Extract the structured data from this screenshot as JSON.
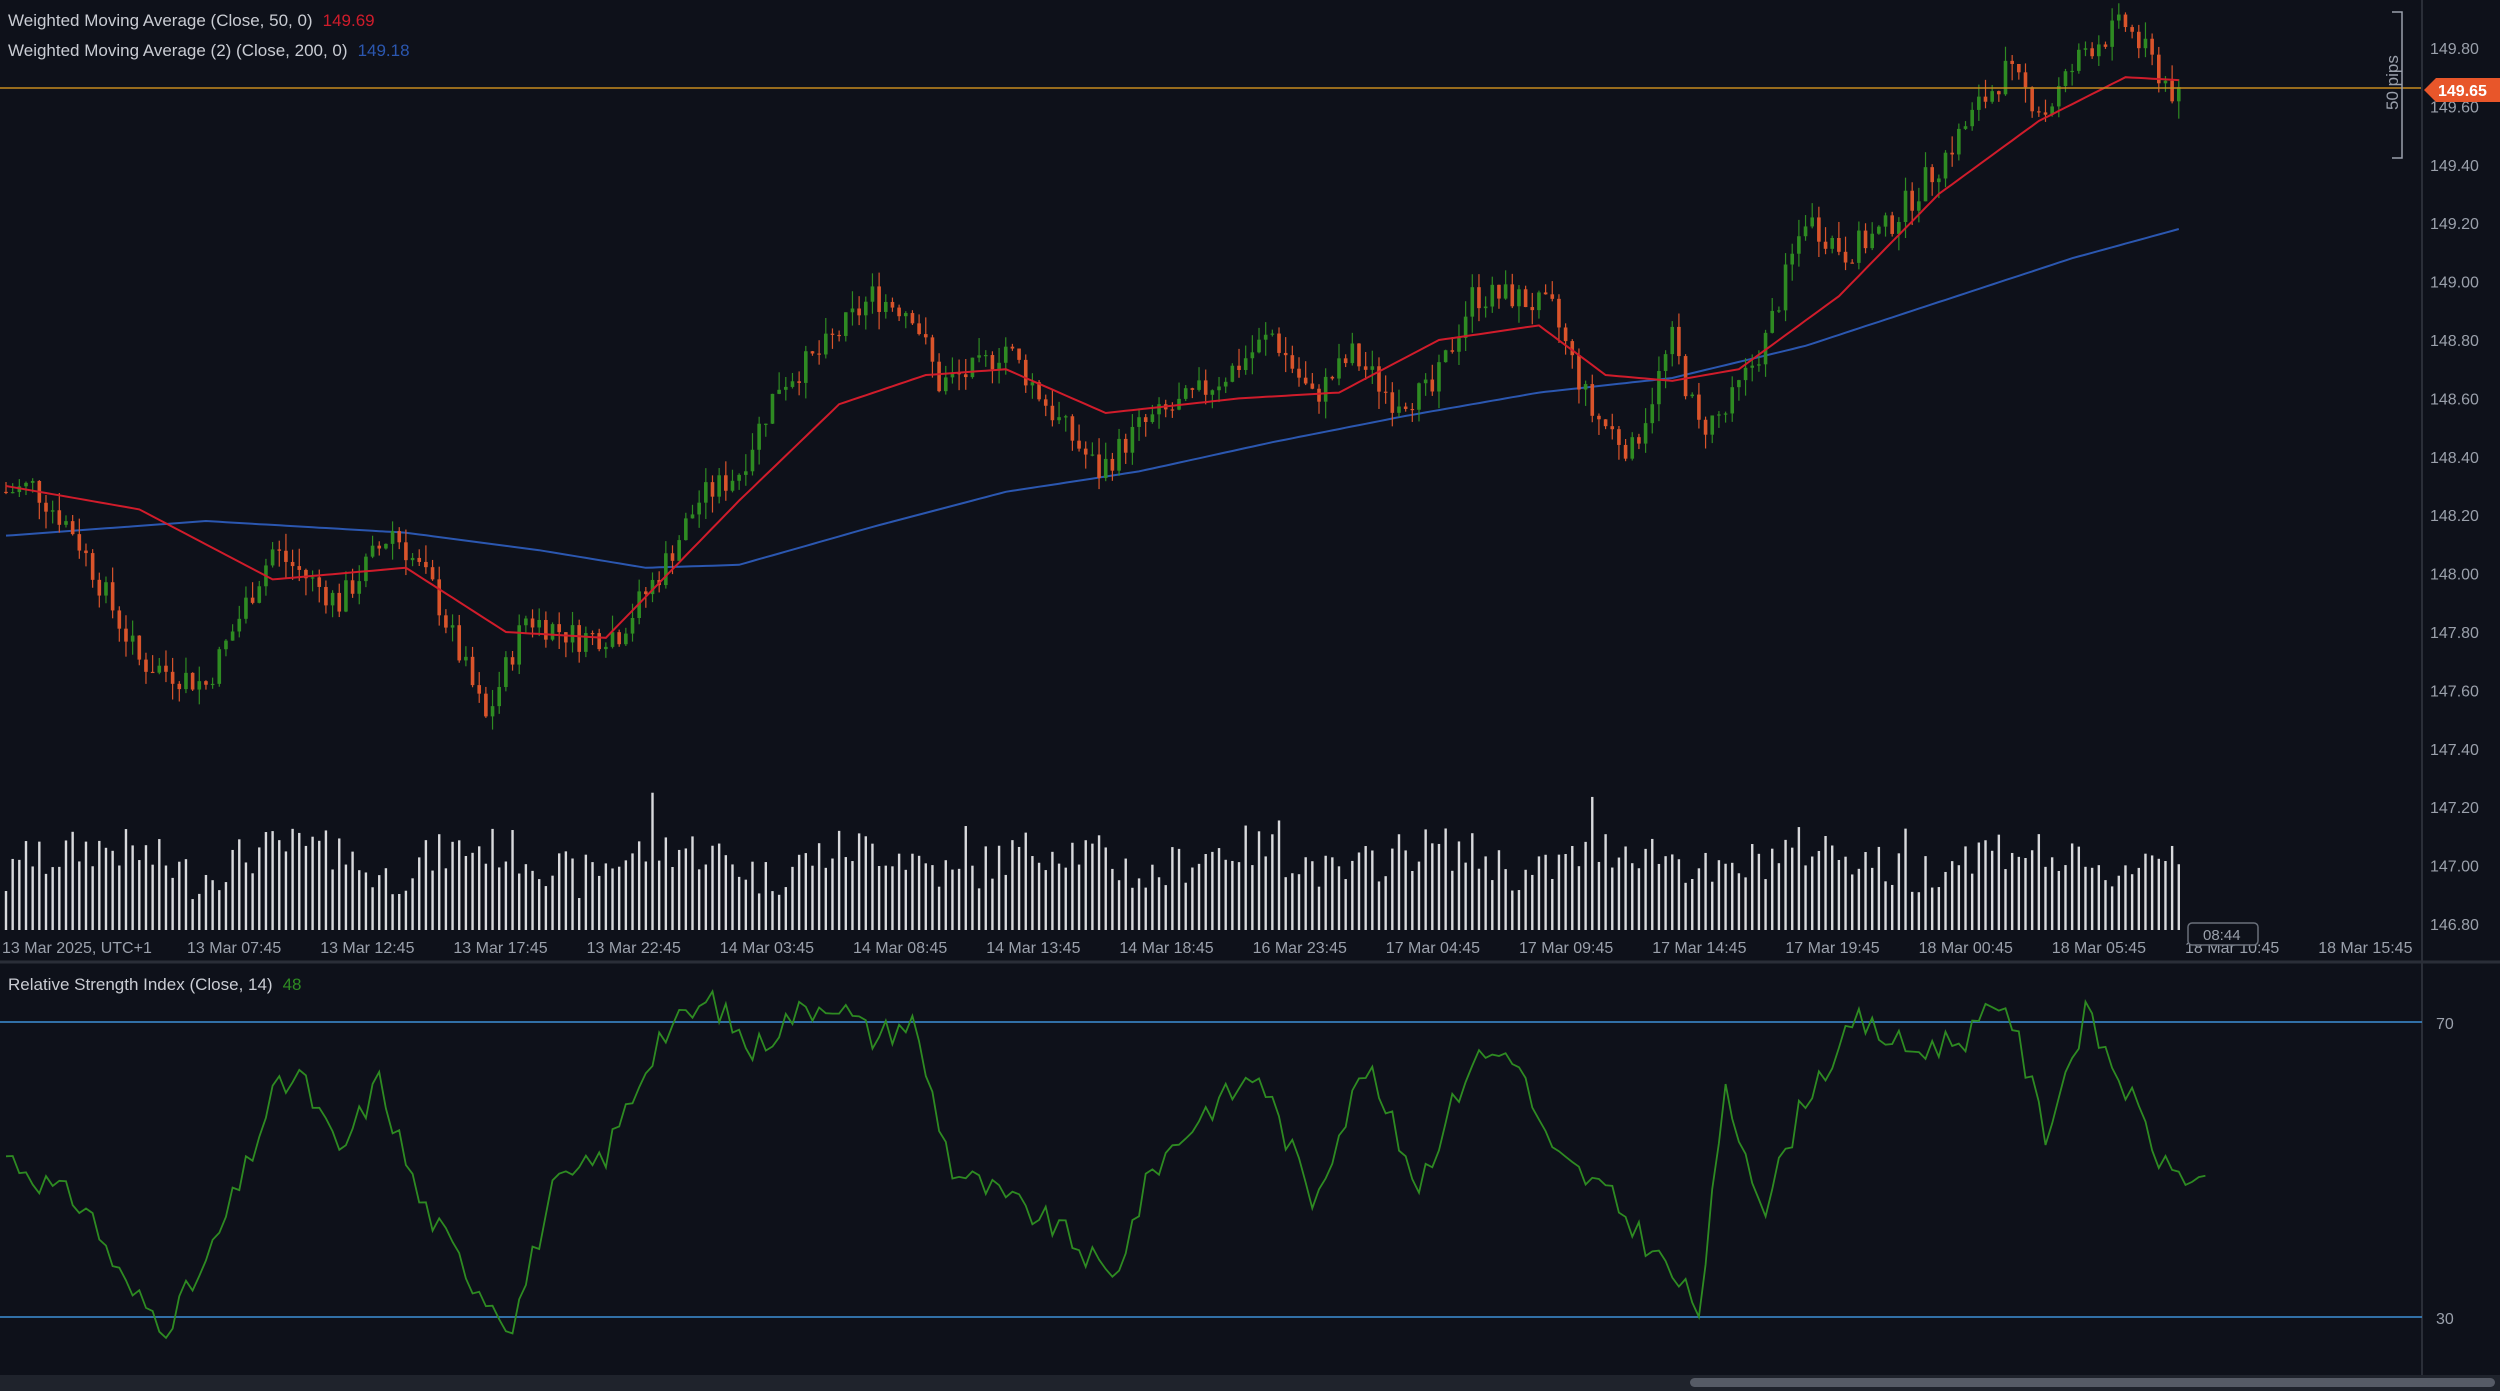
{
  "legends": {
    "wma50": {
      "label": "Weighted Moving Average (Close, 50, 0)",
      "value": "149.69",
      "color": "#d01c2b"
    },
    "wma200": {
      "label": "Weighted Moving Average (2) (Close, 200, 0)",
      "value": "149.18",
      "color": "#2b57b0"
    },
    "rsi": {
      "label": "Relative Strength Index (Close, 14)",
      "value": "48",
      "color": "#2e8b22"
    }
  },
  "price_axis": {
    "ticks": [
      "149.80",
      "149.60",
      "149.40",
      "149.20",
      "149.00",
      "148.80",
      "148.60",
      "148.40",
      "148.20",
      "148.00",
      "147.80",
      "147.60",
      "147.40",
      "147.20",
      "147.00",
      "146.80"
    ],
    "current_price": "149.65",
    "measure_label": "50 pips"
  },
  "time_axis": {
    "ticks": [
      "13 Mar 2025, UTC+1",
      "13 Mar 07:45",
      "13 Mar 12:45",
      "13 Mar 17:45",
      "13 Mar 22:45",
      "14 Mar 03:45",
      "14 Mar 08:45",
      "14 Mar 13:45",
      "14 Mar 18:45",
      "16 Mar 23:45",
      "17 Mar 04:45",
      "17 Mar 09:45",
      "17 Mar 14:45",
      "17 Mar 19:45",
      "18 Mar 00:45",
      "18 Mar 05:45",
      "18 Mar 10:45",
      "18 Mar 15:45"
    ],
    "countdown": "08:44"
  },
  "rsi_axis": {
    "upper": "70",
    "lower": "30"
  },
  "chart_data": [
    {
      "type": "candlestick",
      "name": "price",
      "ylim": [
        146.75,
        149.9
      ],
      "current_price": 149.65,
      "anchors": [
        [
          0,
          148.28
        ],
        [
          4,
          148.3
        ],
        [
          10,
          148.15
        ],
        [
          20,
          147.7
        ],
        [
          30,
          147.62
        ],
        [
          40,
          148.08
        ],
        [
          50,
          147.9
        ],
        [
          58,
          148.15
        ],
        [
          64,
          147.95
        ],
        [
          72,
          147.5
        ],
        [
          78,
          147.85
        ],
        [
          86,
          147.78
        ],
        [
          92,
          147.8
        ],
        [
          98,
          148.0
        ],
        [
          104,
          148.25
        ],
        [
          110,
          148.35
        ],
        [
          116,
          148.65
        ],
        [
          122,
          148.75
        ],
        [
          130,
          148.95
        ],
        [
          136,
          148.9
        ],
        [
          140,
          148.65
        ],
        [
          146,
          148.7
        ],
        [
          150,
          148.78
        ],
        [
          154,
          148.65
        ],
        [
          158,
          148.52
        ],
        [
          164,
          148.35
        ],
        [
          170,
          148.5
        ],
        [
          178,
          148.6
        ],
        [
          184,
          148.7
        ],
        [
          190,
          148.82
        ],
        [
          196,
          148.6
        ],
        [
          202,
          148.75
        ],
        [
          208,
          148.6
        ],
        [
          214,
          148.62
        ],
        [
          220,
          148.95
        ],
        [
          226,
          148.95
        ],
        [
          232,
          148.9
        ],
        [
          238,
          148.55
        ],
        [
          244,
          148.42
        ],
        [
          250,
          148.8
        ],
        [
          254,
          148.5
        ],
        [
          258,
          148.55
        ],
        [
          264,
          148.8
        ],
        [
          270,
          149.22
        ],
        [
          276,
          149.1
        ],
        [
          282,
          149.18
        ],
        [
          290,
          149.4
        ],
        [
          296,
          149.6
        ],
        [
          300,
          149.72
        ],
        [
          306,
          149.58
        ],
        [
          312,
          149.8
        ],
        [
          318,
          149.88
        ],
        [
          322,
          149.75
        ],
        [
          326,
          149.62
        ]
      ],
      "volume": {
        "max_height": 1
      }
    },
    {
      "type": "line",
      "name": "WMA 50",
      "values_at": [
        [
          0,
          148.3
        ],
        [
          20,
          148.22
        ],
        [
          40,
          147.98
        ],
        [
          60,
          148.02
        ],
        [
          75,
          147.8
        ],
        [
          90,
          147.78
        ],
        [
          110,
          148.25
        ],
        [
          125,
          148.58
        ],
        [
          138,
          148.68
        ],
        [
          150,
          148.7
        ],
        [
          165,
          148.55
        ],
        [
          185,
          148.6
        ],
        [
          200,
          148.62
        ],
        [
          215,
          148.8
        ],
        [
          230,
          148.85
        ],
        [
          240,
          148.68
        ],
        [
          250,
          148.66
        ],
        [
          260,
          148.7
        ],
        [
          275,
          148.95
        ],
        [
          290,
          149.3
        ],
        [
          305,
          149.55
        ],
        [
          318,
          149.7
        ],
        [
          326,
          149.69
        ]
      ]
    },
    {
      "type": "line",
      "name": "WMA 200",
      "values_at": [
        [
          0,
          148.13
        ],
        [
          30,
          148.18
        ],
        [
          60,
          148.14
        ],
        [
          80,
          148.08
        ],
        [
          96,
          148.02
        ],
        [
          110,
          148.03
        ],
        [
          130,
          148.16
        ],
        [
          150,
          148.28
        ],
        [
          170,
          148.35
        ],
        [
          190,
          148.45
        ],
        [
          210,
          148.54
        ],
        [
          230,
          148.62
        ],
        [
          250,
          148.67
        ],
        [
          270,
          148.78
        ],
        [
          290,
          148.93
        ],
        [
          310,
          149.08
        ],
        [
          326,
          149.18
        ]
      ]
    },
    {
      "type": "line",
      "name": "RSI 14",
      "ylim": [
        24,
        76
      ],
      "levels": [
        70,
        30
      ],
      "values_at": [
        [
          0,
          52
        ],
        [
          6,
          48
        ],
        [
          12,
          45
        ],
        [
          18,
          34
        ],
        [
          24,
          29
        ],
        [
          30,
          37
        ],
        [
          36,
          50
        ],
        [
          40,
          60
        ],
        [
          44,
          63
        ],
        [
          50,
          52
        ],
        [
          56,
          62
        ],
        [
          62,
          46
        ],
        [
          70,
          35
        ],
        [
          76,
          29
        ],
        [
          82,
          47
        ],
        [
          90,
          52
        ],
        [
          98,
          68
        ],
        [
          106,
          73
        ],
        [
          112,
          66
        ],
        [
          118,
          71
        ],
        [
          124,
          73
        ],
        [
          130,
          68
        ],
        [
          136,
          70
        ],
        [
          142,
          50
        ],
        [
          150,
          46
        ],
        [
          158,
          42
        ],
        [
          166,
          35
        ],
        [
          172,
          50
        ],
        [
          180,
          58
        ],
        [
          188,
          63
        ],
        [
          196,
          46
        ],
        [
          204,
          64
        ],
        [
          212,
          48
        ],
        [
          220,
          65
        ],
        [
          226,
          66
        ],
        [
          232,
          52
        ],
        [
          240,
          47
        ],
        [
          248,
          38
        ],
        [
          254,
          31
        ],
        [
          258,
          60
        ],
        [
          264,
          45
        ],
        [
          270,
          60
        ],
        [
          278,
          70
        ],
        [
          286,
          66
        ],
        [
          294,
          68
        ],
        [
          300,
          73
        ],
        [
          306,
          55
        ],
        [
          312,
          71
        ],
        [
          318,
          61
        ],
        [
          324,
          50
        ],
        [
          328,
          49
        ],
        [
          330,
          48
        ]
      ]
    }
  ]
}
